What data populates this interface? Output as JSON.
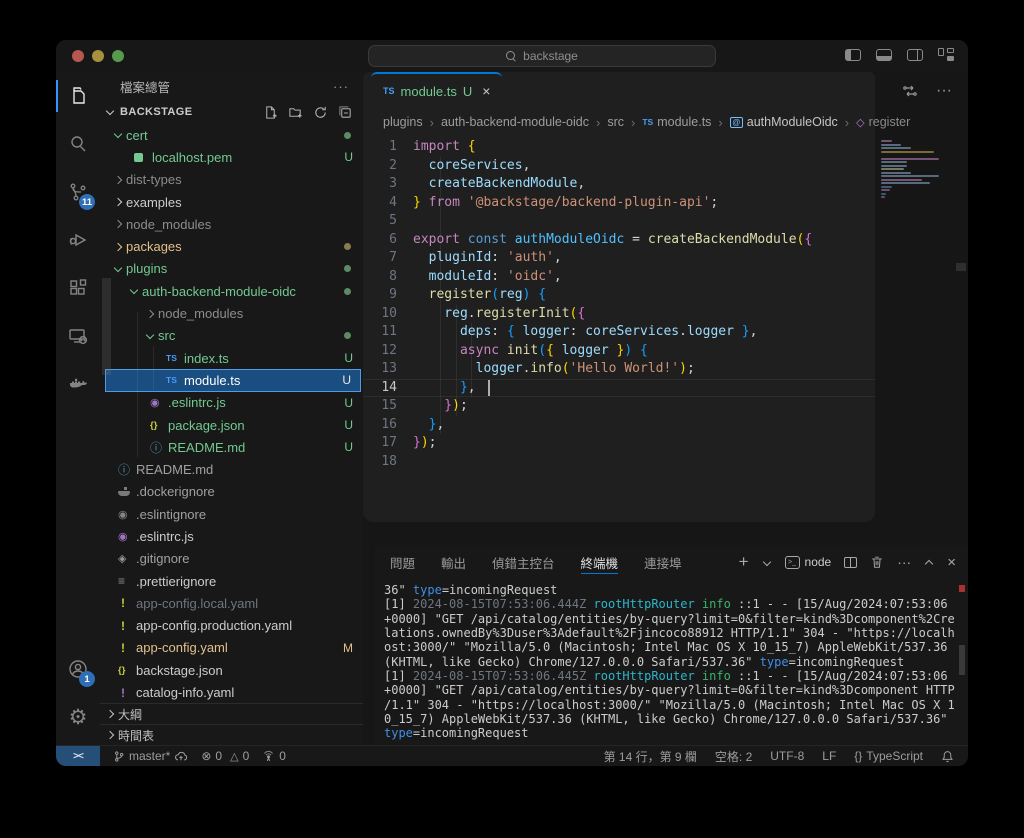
{
  "titlebar": {
    "search_label": "backstage",
    "back_arrow": "←",
    "forward_arrow": "→"
  },
  "activity_bar": {
    "items": [
      {
        "name": "explorer",
        "active": true
      },
      {
        "name": "search"
      },
      {
        "name": "source-control",
        "badge": "11"
      },
      {
        "name": "run-and-debug"
      },
      {
        "name": "extensions"
      },
      {
        "name": "remote-explorer"
      },
      {
        "name": "docker"
      }
    ],
    "scm_badge": "11",
    "accounts_badge": "1"
  },
  "sidebar": {
    "title": "檔案總管",
    "section": "BACKSTAGE",
    "outline": "大綱",
    "timeline": "時間表",
    "tree": [
      {
        "label": "cert",
        "level": 0,
        "kind": "folder",
        "state": "open",
        "color": "green",
        "dot": true
      },
      {
        "label": "localhost.pem",
        "level": 1,
        "kind": "file",
        "icon": "pem",
        "color": "green",
        "badge": "U"
      },
      {
        "label": "dist-types",
        "level": 0,
        "kind": "folder",
        "state": "closed",
        "color": "gray"
      },
      {
        "label": "examples",
        "level": 0,
        "kind": "folder",
        "state": "closed",
        "color": "white"
      },
      {
        "label": "node_modules",
        "level": 0,
        "kind": "folder",
        "state": "closed",
        "color": "gray"
      },
      {
        "label": "packages",
        "level": 0,
        "kind": "folder",
        "state": "closed",
        "color": "yellow",
        "dot": true,
        "dotColor": "yellow"
      },
      {
        "label": "plugins",
        "level": 0,
        "kind": "folder",
        "state": "open",
        "color": "green",
        "dot": true
      },
      {
        "label": "auth-backend-module-oidc",
        "level": 1,
        "kind": "folder",
        "state": "open",
        "color": "green",
        "dot": true
      },
      {
        "label": "node_modules",
        "level": 2,
        "kind": "folder",
        "state": "closed",
        "color": "gray"
      },
      {
        "label": "src",
        "level": 2,
        "kind": "folder",
        "state": "open",
        "color": "green",
        "dot": true
      },
      {
        "label": "index.ts",
        "level": 3,
        "kind": "file",
        "icon": "ts",
        "color": "green",
        "badge": "U"
      },
      {
        "label": "module.ts",
        "level": 3,
        "kind": "file",
        "icon": "ts",
        "color": "white",
        "badge": "U",
        "selected": true
      },
      {
        "label": ".eslintrc.js",
        "level": 2,
        "kind": "file",
        "icon": "eslint",
        "color": "green",
        "badge": "U"
      },
      {
        "label": "package.json",
        "level": 2,
        "kind": "file",
        "icon": "json",
        "color": "green",
        "badge": "U"
      },
      {
        "label": "README.md",
        "level": 2,
        "kind": "file",
        "icon": "info",
        "color": "green",
        "badge": "U"
      },
      {
        "label": "README.md",
        "level": 0,
        "kind": "file",
        "icon": "info",
        "color": "muted"
      },
      {
        "label": ".dockerignore",
        "level": 0,
        "kind": "file",
        "icon": "docker",
        "color": "muted"
      },
      {
        "label": ".eslintignore",
        "level": 0,
        "kind": "file",
        "icon": "eslint-gray",
        "color": "muted"
      },
      {
        "label": ".eslintrc.js",
        "level": 0,
        "kind": "file",
        "icon": "eslint",
        "color": "white"
      },
      {
        "label": ".gitignore",
        "level": 0,
        "kind": "file",
        "icon": "git",
        "color": "muted"
      },
      {
        "label": ".prettierignore",
        "level": 0,
        "kind": "file",
        "icon": "prettier",
        "color": "white"
      },
      {
        "label": "app-config.local.yaml",
        "level": 0,
        "kind": "file",
        "icon": "yaml",
        "color": "dim"
      },
      {
        "label": "app-config.production.yaml",
        "level": 0,
        "kind": "file",
        "icon": "yaml",
        "color": "white"
      },
      {
        "label": "app-config.yaml",
        "level": 0,
        "kind": "file",
        "icon": "yaml",
        "color": "yellow",
        "badge": "M"
      },
      {
        "label": "backstage.json",
        "level": 0,
        "kind": "file",
        "icon": "json",
        "color": "white"
      },
      {
        "label": "catalog-info.yaml",
        "level": 0,
        "kind": "file",
        "icon": "yaml-purple",
        "color": "white"
      }
    ]
  },
  "editor": {
    "tab": {
      "icon": "TS",
      "label": "module.ts",
      "badge": "U",
      "close": "×"
    },
    "breadcrumbs": [
      {
        "label": "plugins"
      },
      {
        "label": "auth-backend-module-oidc"
      },
      {
        "label": "src"
      },
      {
        "label": "module.ts",
        "icon": "ts"
      },
      {
        "label": "authModuleOidc",
        "icon": "symbol-variable",
        "bright": true
      },
      {
        "label": "register",
        "icon": "symbol-method",
        "dim": true
      }
    ],
    "active_line": 14,
    "lines": [
      [
        [
          "kw",
          "import"
        ],
        [
          "b1",
          " {"
        ]
      ],
      [
        [
          "va",
          "  coreServices"
        ],
        [
          "pl",
          ","
        ]
      ],
      [
        [
          "va",
          "  createBackendModule"
        ],
        [
          "pl",
          ","
        ]
      ],
      [
        [
          "b1",
          "} "
        ],
        [
          "kw",
          "from"
        ],
        [
          "st",
          " '@backstage/backend-plugin-api'"
        ],
        [
          "pl",
          ";"
        ]
      ],
      [],
      [
        [
          "kw",
          "export"
        ],
        [
          "ct",
          " const"
        ],
        [
          "cn",
          " authModuleOidc"
        ],
        [
          "pl",
          " = "
        ],
        [
          "fn",
          "createBackendModule"
        ],
        [
          "b1",
          "("
        ],
        [
          "b2",
          "{"
        ]
      ],
      [
        [
          "va",
          "  pluginId"
        ],
        [
          "pl",
          ": "
        ],
        [
          "st",
          "'auth'"
        ],
        [
          "pl",
          ","
        ]
      ],
      [
        [
          "va",
          "  moduleId"
        ],
        [
          "pl",
          ": "
        ],
        [
          "st",
          "'oidc'"
        ],
        [
          "pl",
          ","
        ]
      ],
      [
        [
          "fn",
          "  register"
        ],
        [
          "b3",
          "("
        ],
        [
          "va",
          "reg"
        ],
        [
          "b3",
          ") {"
        ]
      ],
      [
        [
          "va",
          "    reg"
        ],
        [
          "pl",
          "."
        ],
        [
          "fn",
          "registerInit"
        ],
        [
          "b1",
          "("
        ],
        [
          "b2",
          "{"
        ]
      ],
      [
        [
          "va",
          "      deps"
        ],
        [
          "pl",
          ": "
        ],
        [
          "b3",
          "{ "
        ],
        [
          "va",
          "logger"
        ],
        [
          "pl",
          ": "
        ],
        [
          "va",
          "coreServices"
        ],
        [
          "pl",
          "."
        ],
        [
          "va",
          "logger"
        ],
        [
          "b3",
          " }"
        ],
        [
          "pl",
          ","
        ]
      ],
      [
        [
          "kw",
          "      async"
        ],
        [
          "fn",
          " init"
        ],
        [
          "b3",
          "("
        ],
        [
          "b1",
          "{ "
        ],
        [
          "va",
          "logger"
        ],
        [
          "b1",
          " }"
        ],
        [
          "b3",
          ") {"
        ]
      ],
      [
        [
          "va",
          "        logger"
        ],
        [
          "pl",
          "."
        ],
        [
          "fn",
          "info"
        ],
        [
          "b1",
          "("
        ],
        [
          "st",
          "'Hello World!'"
        ],
        [
          "b1",
          ")"
        ],
        [
          "pl",
          ";"
        ]
      ],
      [
        [
          "b3",
          "      }"
        ],
        [
          "pl",
          ","
        ]
      ],
      [
        [
          "b2",
          "    }"
        ],
        [
          "b1",
          ")"
        ],
        [
          "pl",
          ";"
        ]
      ],
      [
        [
          "b3",
          "  }"
        ],
        [
          "pl",
          ","
        ]
      ],
      [
        [
          "b2",
          "}"
        ],
        [
          "b1",
          ")"
        ],
        [
          "pl",
          ";"
        ]
      ],
      []
    ]
  },
  "panel": {
    "tabs": [
      "問題",
      "輸出",
      "偵錯主控台",
      "終端機",
      "連接埠"
    ],
    "active_tab": "終端機",
    "shell_label": "node",
    "terminal_lines": [
      [
        [
          "w",
          "36\" "
        ],
        [
          "bl",
          "type"
        ],
        [
          "w",
          "=incomingRequest"
        ]
      ],
      [
        [
          "w",
          "[1] "
        ],
        [
          "g",
          "2024-08-15T07:53:06.444Z "
        ],
        [
          "t",
          "rootHttpRouter "
        ],
        [
          "gn",
          "info "
        ],
        [
          "w",
          "::1 - - [15/Aug/2024:07:53:06"
        ]
      ],
      [
        [
          "w",
          "+0000] \"GET /api/catalog/entities/by-query?limit=0&filter=kind%3Dcomponent%2Cre"
        ]
      ],
      [
        [
          "w",
          "lations.ownedBy%3Duser%3Adefault%2Fjincoco88912 HTTP/1.1\" 304 - \"https://localh"
        ]
      ],
      [
        [
          "w",
          "ost:3000/\" \"Mozilla/5.0 (Macintosh; Intel Mac OS X 10_15_7) AppleWebKit/537.36"
        ]
      ],
      [
        [
          "w",
          "(KHTML, like Gecko) Chrome/127.0.0.0 Safari/537.36\" "
        ],
        [
          "bl",
          "type"
        ],
        [
          "w",
          "=incomingRequest"
        ]
      ],
      [
        [
          "w",
          "[1] "
        ],
        [
          "g",
          "2024-08-15T07:53:06.445Z "
        ],
        [
          "t",
          "rootHttpRouter "
        ],
        [
          "gn",
          "info "
        ],
        [
          "w",
          "::1 - - [15/Aug/2024:07:53:06"
        ]
      ],
      [
        [
          "w",
          "+0000] \"GET /api/catalog/entities/by-query?limit=0&filter=kind%3Dcomponent HTTP"
        ]
      ],
      [
        [
          "w",
          "/1.1\" 304 - \"https://localhost:3000/\" \"Mozilla/5.0 (Macintosh; Intel Mac OS X 1"
        ]
      ],
      [
        [
          "w",
          "0_15_7) AppleWebKit/537.36 (KHTML, like Gecko) Chrome/127.0.0.0 Safari/537.36\""
        ]
      ],
      [
        [
          "bl",
          "type"
        ],
        [
          "w",
          "=incomingRequest"
        ]
      ]
    ]
  },
  "status_bar": {
    "branch": "master*",
    "errors": "0",
    "warnings": "0",
    "broadcast": "0",
    "line_col": "第 14 行，第 9 欄",
    "indent": "空格: 2",
    "encoding": "UTF-8",
    "eol": "LF",
    "language_icon": "{}",
    "language": "TypeScript"
  },
  "colors": {
    "accent_blue": "#0078d4",
    "git_untracked_green": "#73C991",
    "git_modified_yellow": "#E2C08D",
    "editor_bg": "#1f1f1f",
    "workbench_bg": "#181818",
    "remote_indicator_bg": "#264f78"
  }
}
